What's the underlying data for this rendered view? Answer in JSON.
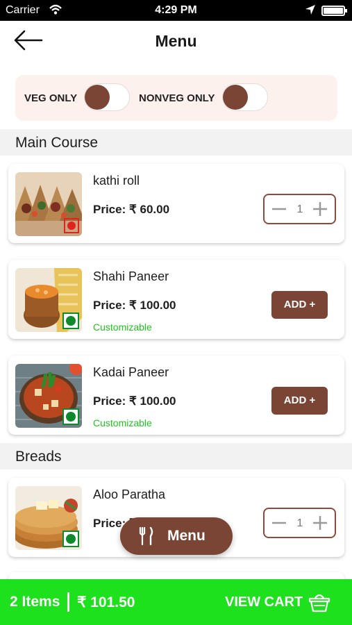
{
  "status_bar": {
    "carrier": "Carrier",
    "time": "4:29 PM"
  },
  "header": {
    "title": "Menu",
    "back_icon": "arrow-left-icon"
  },
  "filters": {
    "veg_label": "VEG ONLY",
    "nonveg_label": "NONVEG ONLY"
  },
  "sections": [
    "Main Course",
    "Breads"
  ],
  "items": [
    {
      "name": "kathi roll",
      "price": "Price: ₹ 60.00",
      "qty": "1",
      "type": "nonveg"
    },
    {
      "name": "Shahi Paneer",
      "price": "Price: ₹ 100.00",
      "custom": "Customizable",
      "action": "ADD +",
      "type": "veg"
    },
    {
      "name": "Kadai Paneer",
      "price": "Price: ₹ 100.00",
      "custom": "Customizable",
      "action": "ADD +",
      "type": "veg"
    },
    {
      "name": "Aloo Paratha",
      "price": "Price: ₹",
      "qty": "1",
      "type": "veg"
    }
  ],
  "fab": {
    "label": "Menu",
    "icon": "fork-knife-icon"
  },
  "cart": {
    "items": "2 Items",
    "total": "₹ 101.50",
    "action": "VIEW CART",
    "icon": "basket-icon"
  },
  "colors": {
    "brand": "#7a4535",
    "accent_green": "#1ee11e",
    "veg": "#0e8a2c",
    "nonveg": "#e0231c",
    "filter_bg": "#fdf1ee"
  }
}
